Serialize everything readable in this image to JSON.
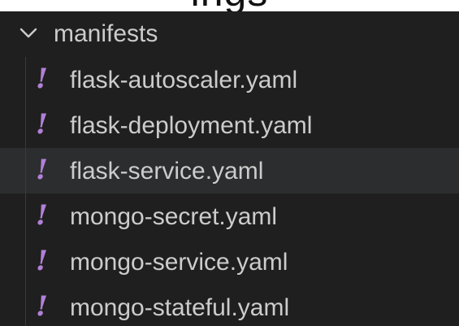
{
  "header": {
    "clipped_title": "ings"
  },
  "explorer": {
    "folder": {
      "label": "manifests",
      "icon": "chevron-down-icon",
      "expanded": true
    },
    "files": [
      {
        "label": "flask-autoscaler.yaml",
        "icon": "yaml-file-icon",
        "icon_glyph": "!"
      },
      {
        "label": "flask-deployment.yaml",
        "icon": "yaml-file-icon",
        "icon_glyph": "!"
      },
      {
        "label": "flask-service.yaml",
        "icon": "yaml-file-icon",
        "icon_glyph": "!",
        "hovered": true
      },
      {
        "label": "mongo-secret.yaml",
        "icon": "yaml-file-icon",
        "icon_glyph": "!"
      },
      {
        "label": "mongo-service.yaml",
        "icon": "yaml-file-icon",
        "icon_glyph": "!"
      },
      {
        "label": "mongo-stateful.yaml",
        "icon": "yaml-file-icon",
        "icon_glyph": "!"
      }
    ]
  },
  "colors": {
    "panel_background": "#1f1f1f",
    "hover_background": "#2b2d2e",
    "text": "#cccccc",
    "yaml_icon": "#b180d7"
  }
}
